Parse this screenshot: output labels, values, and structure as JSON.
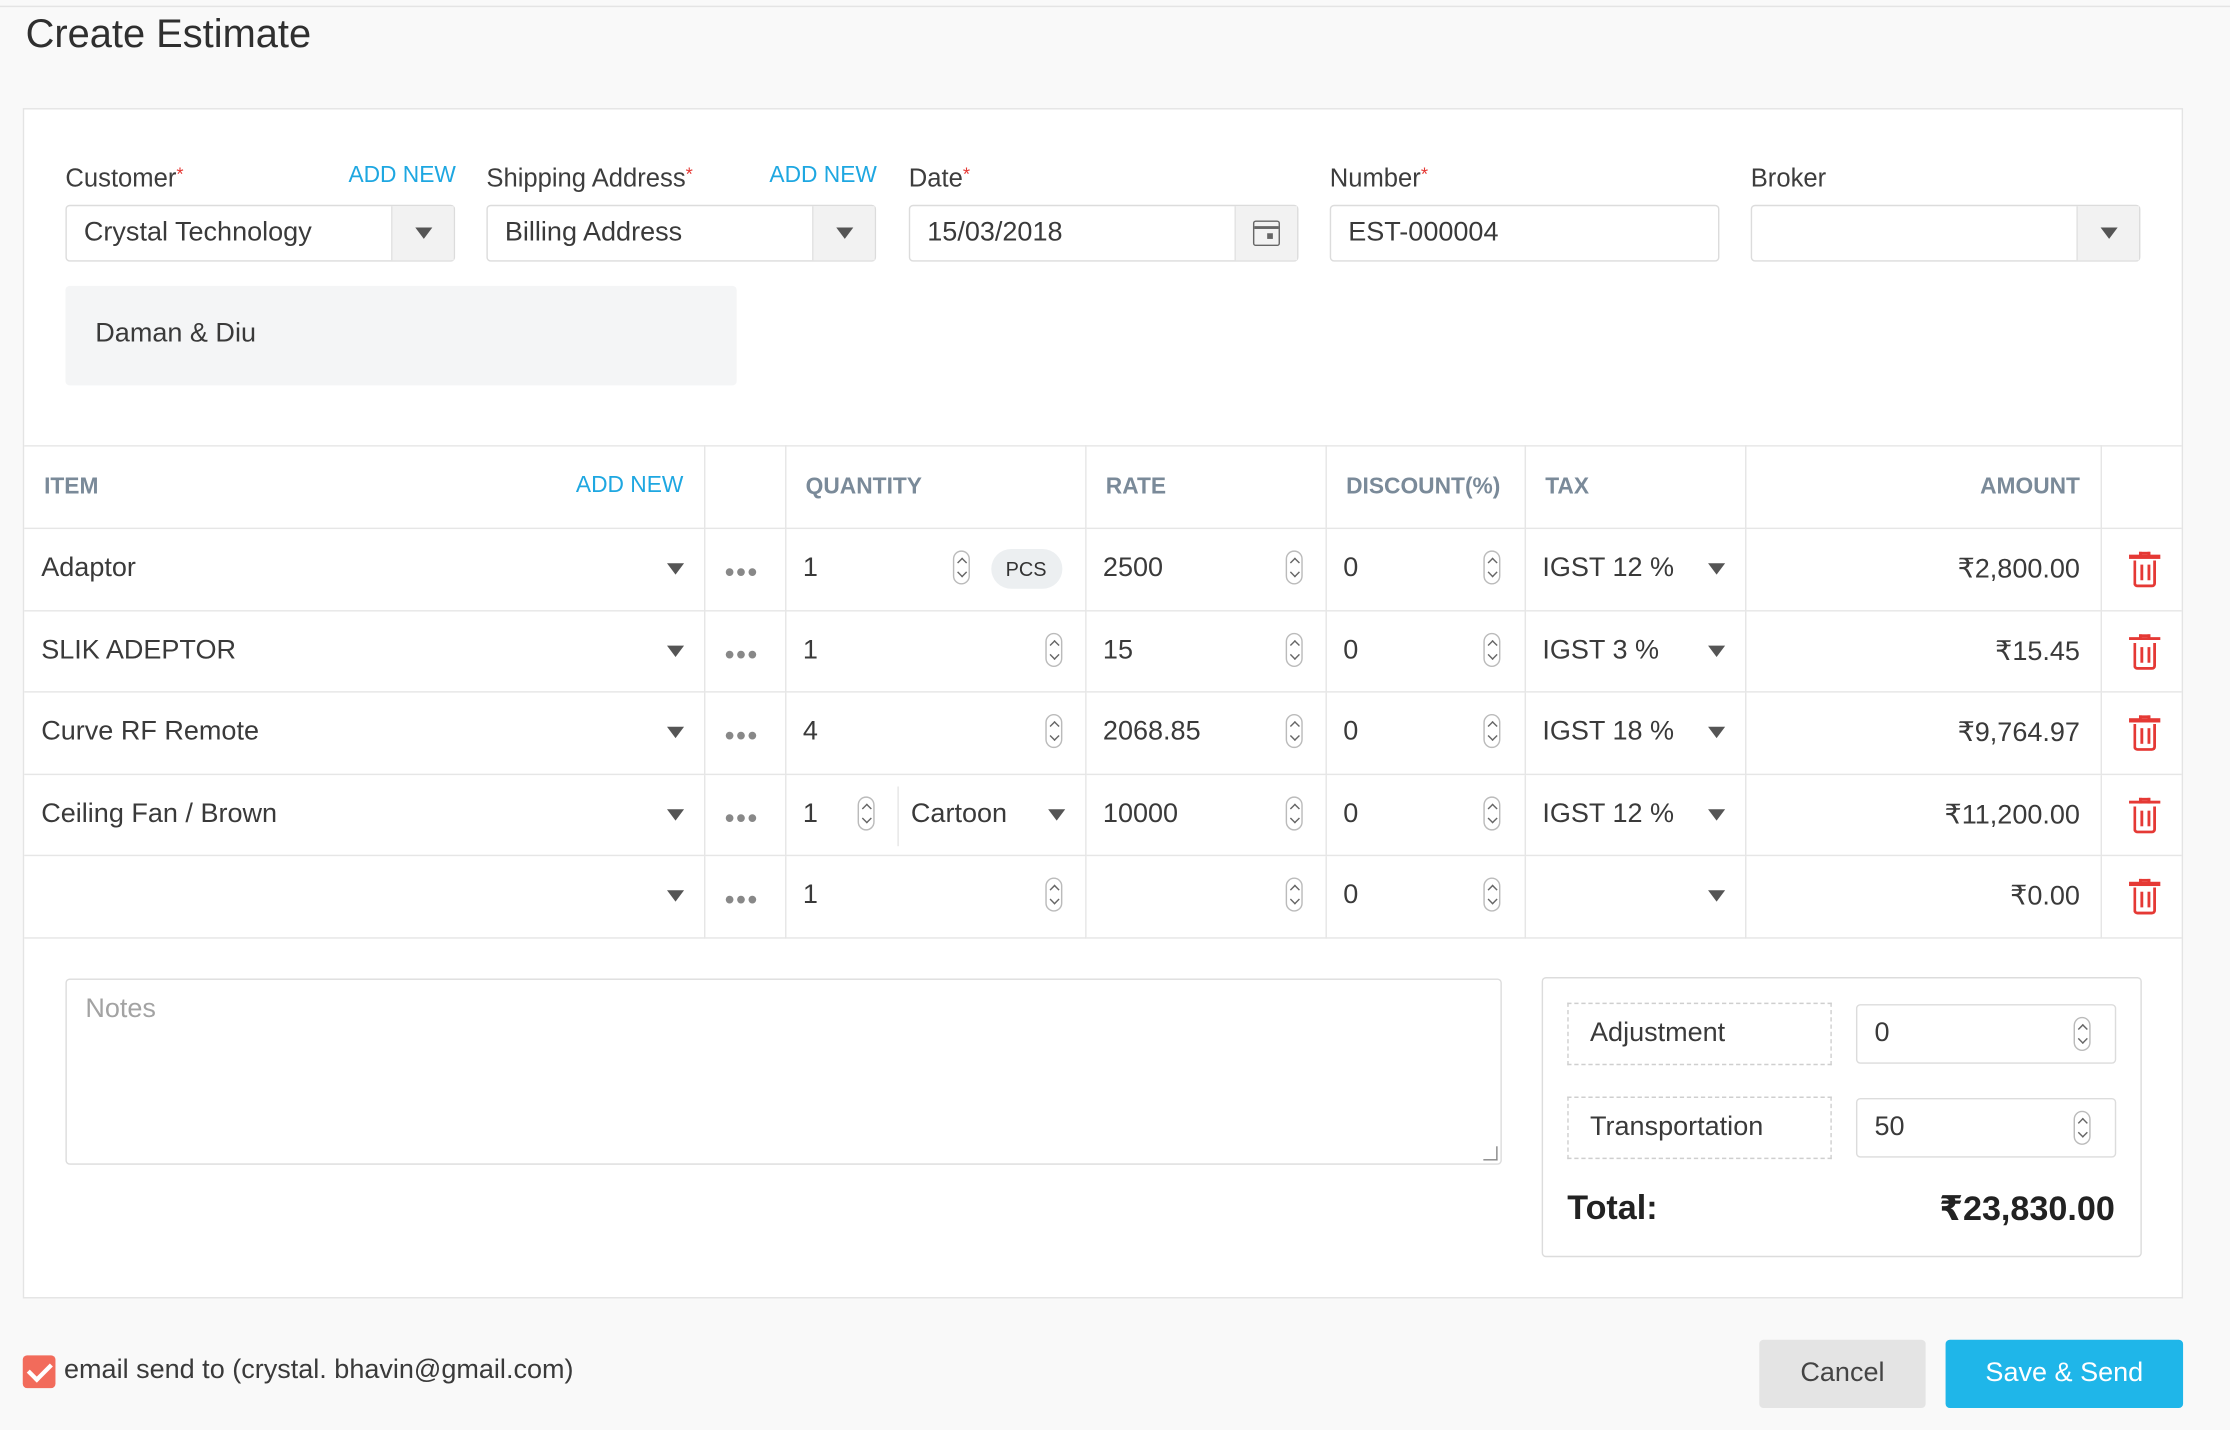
{
  "page": {
    "title": "Create Estimate"
  },
  "header_fields": {
    "customer": {
      "label": "Customer",
      "required": "*",
      "add_new": "ADD NEW",
      "value": "Crystal Technology"
    },
    "shipping": {
      "label": "Shipping Address",
      "required": "*",
      "add_new": "ADD NEW",
      "value": "Billing Address"
    },
    "date": {
      "label": "Date",
      "required": "*",
      "value": "15/03/2018"
    },
    "number": {
      "label": "Number",
      "required": "*",
      "value": "EST-000004"
    },
    "broker": {
      "label": "Broker",
      "value": ""
    },
    "state": "Daman & Diu"
  },
  "table": {
    "headers": {
      "item": "ITEM",
      "add_new": "ADD NEW",
      "quantity": "QUANTITY",
      "rate": "RATE",
      "discount": "DISCOUNT(%)",
      "tax": "TAX",
      "amount": "AMOUNT"
    },
    "more_label": "•••",
    "rows": [
      {
        "item": "Adaptor",
        "qty": "1",
        "unit": "PCS",
        "rate": "2500",
        "discount": "0",
        "tax": "IGST 12 %",
        "amount": "₹2,800.00"
      },
      {
        "item": "SLIK ADEPTOR",
        "qty": "1",
        "unit": "",
        "rate": "15",
        "discount": "0",
        "tax": "IGST 3 %",
        "amount": "₹15.45"
      },
      {
        "item": "Curve RF Remote",
        "qty": "4",
        "unit": "",
        "rate": "2068.85",
        "discount": "0",
        "tax": "IGST 18 %",
        "amount": "₹9,764.97"
      },
      {
        "item": "Ceiling Fan / Brown",
        "qty": "1",
        "unit": "Cartoon",
        "rate": "10000",
        "discount": "0",
        "tax": "IGST 12 %",
        "amount": "₹11,200.00"
      },
      {
        "item": "",
        "qty": "1",
        "unit": "",
        "rate": "",
        "discount": "0",
        "tax": "",
        "amount": "₹0.00"
      }
    ]
  },
  "notes": {
    "placeholder": "Notes"
  },
  "summary": {
    "adjustment_label": "Adjustment",
    "adjustment_value": "0",
    "transportation_label": "Transportation",
    "transportation_value": "50",
    "total_label": "Total:",
    "total_value": "₹23,830.00"
  },
  "footer": {
    "email_text": "email send to (crystal. bhavin@gmail.com)",
    "cancel": "Cancel",
    "save_send": "Save & Send"
  },
  "colors": {
    "accent": "#1fb6e9",
    "link": "#1ea7e1",
    "danger": "#e53935",
    "checkbox": "#f26b5b"
  }
}
